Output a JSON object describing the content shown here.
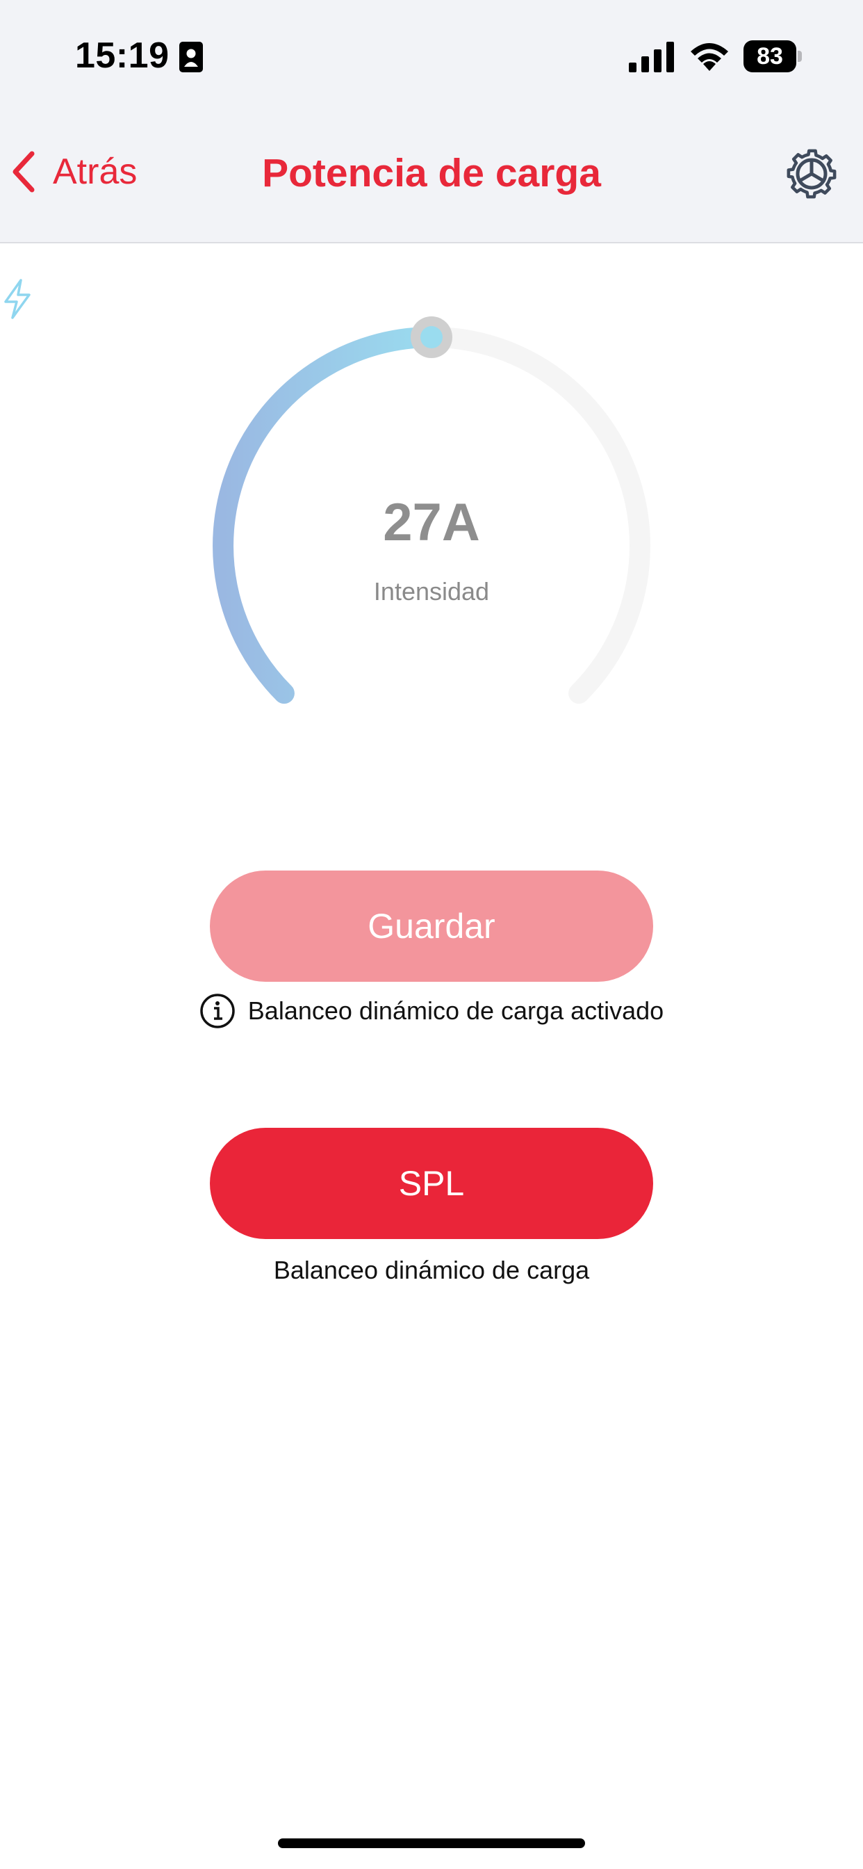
{
  "status_bar": {
    "time": "15:19",
    "battery_level": "83",
    "icons": [
      "contact-card-icon",
      "cellular-signal-icon",
      "wifi-icon",
      "battery-icon"
    ]
  },
  "nav": {
    "back_label": "Atrás",
    "title": "Potencia de carga",
    "icons": [
      "chevron-left-icon",
      "gear-icon"
    ]
  },
  "colors": {
    "accent": "#e8283a",
    "primary_button": "#ea2539",
    "disabled_button": "#f3959c",
    "gauge_gradient_start": "#9ab8e2",
    "gauge_gradient_end": "#9adcef",
    "gauge_track": "#f5f5f5"
  },
  "gauge": {
    "value": "27A",
    "label": "Intensidad",
    "level_fraction": 0.5,
    "icon": "lightning-bolt-icon"
  },
  "actions": {
    "save_label": "Guardar",
    "info_text": "Balanceo dinámico de carga activado",
    "spl_label": "SPL",
    "spl_caption": "Balanceo dinámico de carga"
  }
}
